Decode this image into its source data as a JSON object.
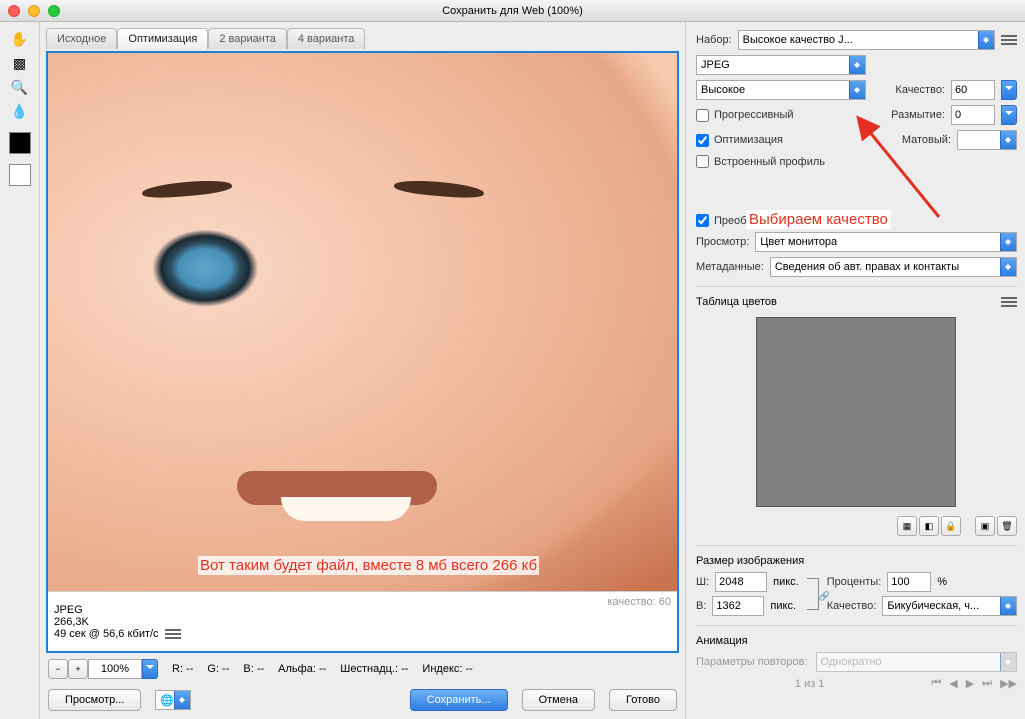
{
  "window": {
    "title": "Сохранить для Web (100%)"
  },
  "tabs": {
    "source": "Исходное",
    "optimize": "Оптимизация",
    "two": "2 варианта",
    "four": "4 варианта"
  },
  "info": {
    "format": "JPEG",
    "size": "266,3K",
    "time": "49 сек @ 56,6 кбит/c",
    "qual_label": "качество: 60"
  },
  "annot": {
    "main": "Вот таким будет файл, вместе 8 мб всего 266 кб",
    "side": "Выбираем качество"
  },
  "bottom": {
    "zoom": "100%",
    "r": "R: --",
    "g": "G: --",
    "b": "B: --",
    "alpha": "Альфа: --",
    "hex": "Шестнадц.: --",
    "index": "Индекс: --"
  },
  "actions": {
    "preview": "Просмотр...",
    "save": "Сохранить...",
    "cancel": "Отмена",
    "done": "Готово"
  },
  "side": {
    "preset_label": "Набор:",
    "preset_value": "Высокое качество J...",
    "format": "JPEG",
    "quality_preset": "Высокое",
    "quality_label": "Качество:",
    "quality_value": "60",
    "progressive": "Прогрессивный",
    "blur_label": "Размытие:",
    "blur_value": "0",
    "optimized": "Оптимизация",
    "matte_label": "Матовый:",
    "embed_profile": "Встроенный профиль",
    "srgb": "Преобразовать в sRGB",
    "view_label": "Просмотр:",
    "view_value": "Цвет монитора",
    "meta_label": "Метаданные:",
    "meta_value": "Сведения об авт. правах и контакты",
    "ct_title": "Таблица цветов",
    "imgsize_title": "Размер изображения",
    "w_label": "Ш:",
    "w_value": "2048",
    "h_label": "В:",
    "h_value": "1362",
    "px": "пикс.",
    "percent_label": "Проценты:",
    "percent_value": "100",
    "percent_suffix": "%",
    "resample_label": "Качество:",
    "resample_value": "Бикубическая, ч...",
    "anim_title": "Анимация",
    "loop_label": "Параметры повторов:",
    "loop_value": "Однократно",
    "pager": "1 из 1"
  }
}
